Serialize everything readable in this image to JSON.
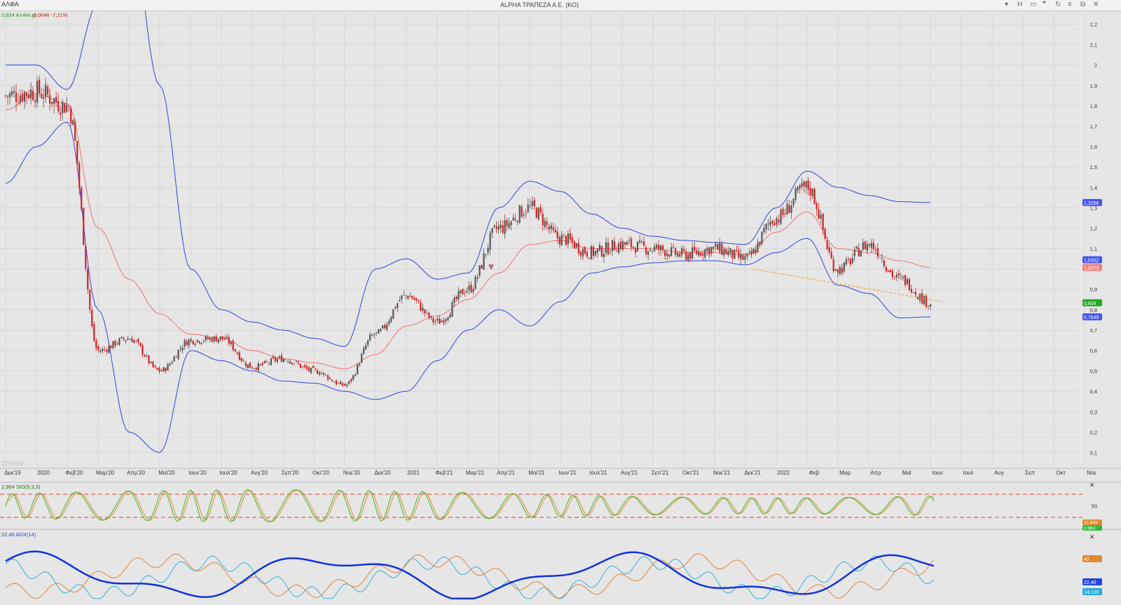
{
  "window": {
    "symbol": "ΑΛΦΑ",
    "title": "ALPHA ΤΡΑΠΕΖΑ Α.Ε. (ΚΟ)",
    "controls": [
      {
        "name": "dropdown-icon",
        "glyph": "▾"
      },
      {
        "name": "h-button",
        "glyph": "H"
      },
      {
        "name": "panel-icon",
        "glyph": "▭"
      },
      {
        "name": "quote-icon",
        "glyph": "❞"
      },
      {
        "name": "refresh-icon",
        "glyph": "↻"
      },
      {
        "name": "menu-icon",
        "glyph": "≡"
      },
      {
        "name": "restore-icon",
        "glyph": "⧉"
      },
      {
        "name": "close-icon",
        "glyph": "✕"
      }
    ]
  },
  "price_panel": {
    "info": "0,834 ΑΛΦΑ.gr -0,0648 -7,21%",
    "info_colors": {
      "value": "#1a9a1a",
      "change": "#d01818"
    },
    "y_ticks": [
      "0,1",
      "0,2",
      "0,3",
      "0,4",
      "0,5",
      "0,6",
      "0,7",
      "0,8",
      "0,9",
      "1",
      "1,1",
      "1,2",
      "1,3",
      "1,4",
      "1,5",
      "1,6",
      "1,7",
      "1,8",
      "1,9",
      "2",
      "2,1",
      "2,2"
    ],
    "badges": [
      {
        "text": "1,3256",
        "value": 1.3256,
        "color": "#4455ee"
      },
      {
        "text": "1,0452",
        "value": 1.0452,
        "color": "#4455ee"
      },
      {
        "text": "1,0073",
        "value": 1.0073,
        "color": "#f08080"
      },
      {
        "text": "0,834",
        "value": 0.834,
        "color": "#22aa22"
      },
      {
        "text": "0,7649",
        "value": 0.7649,
        "color": "#4455ee"
      }
    ],
    "watermark": "ZTRADE"
  },
  "x_axis": {
    "labels": [
      "Δεκ'19",
      "2020",
      "Φεβ'20",
      "Μαρ'20",
      "Απρ'20",
      "Μαϊ'20",
      "Ιουν'20",
      "Ιουλ'20",
      "Αυγ'20",
      "Σεπ'20",
      "Οκτ'20",
      "Νοε'20",
      "Δεκ'20",
      "2021",
      "Φεβ'21",
      "Μαρ'21",
      "Απρ'21",
      "Μαϊ'21",
      "Ιουν'21",
      "Ιουλ'21",
      "Αυγ'21",
      "Σεπ'21",
      "Οκτ'21",
      "Νοε'21",
      "Δεκ'21",
      "2022",
      "Φεβ",
      "Μαρ",
      "Απρ",
      "Μαϊ",
      "Ιουν",
      "Ιουλ",
      "Αυγ",
      "Σεπ",
      "Οκτ",
      "Νοε"
    ]
  },
  "stoch_panel": {
    "title": "2,964 StO(5,3,3)",
    "tick": "50",
    "badges": [
      {
        "text": "11,949",
        "color": "#e08a30"
      },
      {
        "text": "2,964",
        "color": "#33bb33"
      }
    ]
  },
  "adx_panel": {
    "title": "22,40 ADX(14)",
    "badges": [
      {
        "text": "42",
        "color": "#e08a30"
      },
      {
        "text": "22,40",
        "color": "#2244dd"
      },
      {
        "text": "14,100",
        "color": "#22aadd"
      }
    ]
  },
  "colors": {
    "up": "#555555",
    "down": "#d42020",
    "bollinger": "#3344dd",
    "ma": "#f07070",
    "stoch_k": "#4cb82c",
    "stoch_d": "#e08a30",
    "stoch_fill": "#8ed070",
    "adx": "#1133dd",
    "plus_di": "#22aadd",
    "minus_di": "#e07a25",
    "trend": "#f0a030",
    "levels": "#e04040"
  },
  "chart_data": {
    "type": "line",
    "title": "ALPHA ΤΡΑΠΕΖΑ Α.Ε. (ΚΟ)",
    "series_type": "candlestick with bollinger bands and moving average",
    "x": [
      "Δεκ'19",
      "2020",
      "Φεβ'20",
      "Μαρ'20",
      "Απρ'20",
      "Μαϊ'20",
      "Ιουν'20",
      "Ιουλ'20",
      "Αυγ'20",
      "Σεπ'20",
      "Οκτ'20",
      "Νοε'20",
      "Δεκ'20",
      "2021",
      "Φεβ'21",
      "Μαρ'21",
      "Απρ'21",
      "Μαϊ'21",
      "Ιουν'21",
      "Ιουλ'21",
      "Αυγ'21",
      "Σεπ'21",
      "Οκτ'21",
      "Νοε'21",
      "Δεκ'21",
      "2022",
      "Φεβ",
      "Μαρ",
      "Απρ",
      "Μαϊ",
      "Ιουν"
    ],
    "ylim": [
      0.05,
      2.25
    ],
    "series": [
      {
        "name": "ΑΛΦΑ",
        "values": [
          1.85,
          1.87,
          1.8,
          0.6,
          0.66,
          0.5,
          0.65,
          0.66,
          0.52,
          0.56,
          0.5,
          0.43,
          0.68,
          0.87,
          0.74,
          0.9,
          1.2,
          1.3,
          1.15,
          1.08,
          1.12,
          1.1,
          1.07,
          1.1,
          1.05,
          1.25,
          1.4,
          1.0,
          1.12,
          0.95,
          0.834
        ]
      },
      {
        "values": [
          1.78,
          1.86,
          1.81,
          1.2,
          0.95,
          0.78,
          0.68,
          0.66,
          0.6,
          0.56,
          0.54,
          0.51,
          0.58,
          0.72,
          0.77,
          0.85,
          0.98,
          1.12,
          1.14,
          1.1,
          1.1,
          1.1,
          1.08,
          1.08,
          1.07,
          1.18,
          1.28,
          1.1,
          1.08,
          1.04,
          1.0073
        ]
      },
      {
        "values": [
          2.0,
          2.0,
          1.88,
          2.3,
          2.7,
          1.9,
          1.0,
          0.8,
          0.74,
          0.7,
          0.66,
          0.62,
          1.0,
          1.05,
          0.95,
          0.98,
          1.3,
          1.43,
          1.38,
          1.27,
          1.2,
          1.16,
          1.14,
          1.13,
          1.12,
          1.3,
          1.48,
          1.4,
          1.36,
          1.33,
          1.3256
        ]
      },
      {
        "values": [
          1.42,
          1.6,
          1.72,
          0.8,
          0.2,
          0.1,
          0.6,
          0.55,
          0.5,
          0.45,
          0.44,
          0.4,
          0.36,
          0.4,
          0.55,
          0.7,
          0.8,
          0.72,
          0.84,
          0.98,
          1.01,
          1.03,
          1.04,
          1.04,
          1.02,
          1.08,
          1.15,
          0.92,
          0.88,
          0.76,
          0.7649
        ]
      }
    ],
    "horizontal_levels": [
      20,
      80
    ],
    "indicators": [
      "StO(5,3,3)",
      "ADX(14)"
    ]
  }
}
